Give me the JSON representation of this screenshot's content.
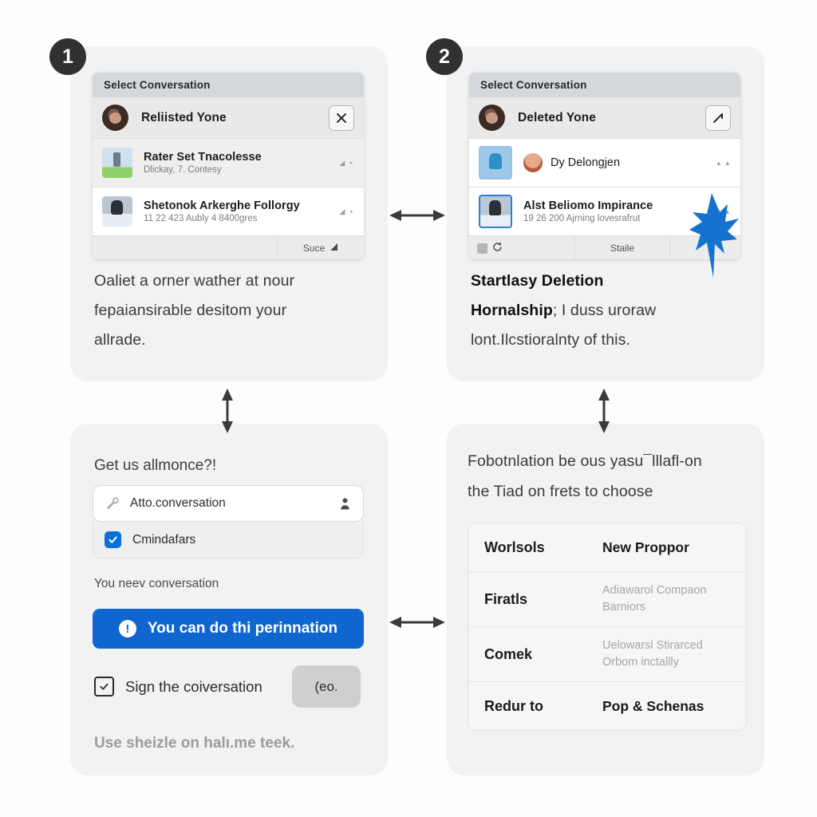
{
  "steps": {
    "one": "1",
    "two": "2"
  },
  "panel1": {
    "dialog": {
      "title": "Select Conversation",
      "header": {
        "name": "Reliisted Yone",
        "close_icon": "close-icon"
      },
      "rows": [
        {
          "title": "Rater Set Tnacolesse",
          "subtitle": "Dlickay, 7. Contesy",
          "meta": "◢ ▪"
        },
        {
          "title": "Shetonok Arkerghe Follorgy",
          "subtitle": "11 22 423 Aubly 4 8400gres",
          "meta": "◢ ▪"
        }
      ],
      "footer": {
        "left": "",
        "right": "Suce"
      }
    },
    "caption": {
      "line1": "Oaliet a orner wather at nour",
      "line2": "fepaiansirable desitom your",
      "line3": "allrade."
    }
  },
  "panel2": {
    "dialog": {
      "title": "Select Conversation",
      "header": {
        "name": "Deleted Yone",
        "edit_icon": "edit-pencil-icon"
      },
      "rows": [
        {
          "title": "Dy Delongjen",
          "subtitle": "",
          "meta": "▴ ▴"
        },
        {
          "title": "Alst Beliomo Impirance",
          "subtitle": "19 26 200 Ajrning lovesrafrut",
          "meta": "▾ ▴"
        }
      ],
      "footer": {
        "middle": "Staile"
      }
    },
    "caption": {
      "bold1": "Startlasy Deletion",
      "bold2": "Hornalship",
      "rest1": "; I duss uroraw",
      "line3": "lont.Ilcstioralnty of this."
    }
  },
  "panel3": {
    "heading": "Get us allmonce?!",
    "input": {
      "value": "Atto.conversation",
      "placeholder": "Atto.conversation",
      "left_icon": "tag-icon",
      "right_icon": "person-icon"
    },
    "checkbox_row": {
      "label": "Cmindafars",
      "checked": true
    },
    "helper": "You neev conversation",
    "primary_button": {
      "label": "You can do thi perinnation",
      "icon": "alert-icon",
      "color": "#0f66d0"
    },
    "sign_row": {
      "label": "Sign the coiversation",
      "checked": true
    },
    "ghost_button": "(eo.",
    "footnote": "Use sheizle on halı.me teek."
  },
  "panel4": {
    "caption": {
      "line1": "Fobotnlation be ous yasu¯lllafl-on",
      "line2": "the Tiad on frets to choose"
    },
    "table": {
      "headers": [
        "Worlsols",
        "New Proppor"
      ],
      "rows": [
        {
          "label": "Firatls",
          "value": "Adiawarol Compaon Barniors",
          "muted": true
        },
        {
          "label": "Comek",
          "value": "Uelowarsl Stirarced Orbom inctallly",
          "muted": true
        },
        {
          "label": "Redur to",
          "value": "Pop & Schenas",
          "muted": false
        }
      ]
    }
  },
  "connectors": {
    "top_horizontal": "double-arrow-horizontal",
    "bottom_horizontal": "double-arrow-horizontal",
    "left_vertical": "double-arrow-vertical",
    "right_vertical": "double-arrow-vertical"
  },
  "cursor": {
    "name": "blue-pointer-cursor",
    "color": "#1573cf"
  }
}
